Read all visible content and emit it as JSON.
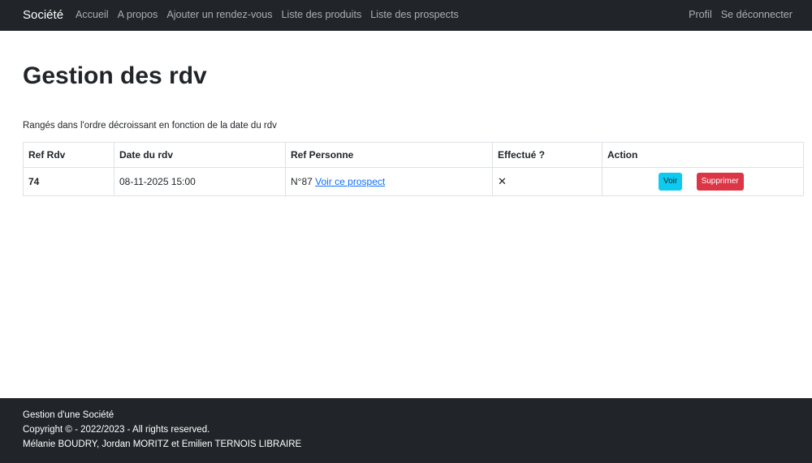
{
  "navbar": {
    "brand": "Société",
    "links": [
      "Accueil",
      "A propos",
      "Ajouter un rendez-vous",
      "Liste des produits",
      "Liste des prospects"
    ],
    "right_links": [
      "Profil",
      "Se déconnecter"
    ]
  },
  "page": {
    "title": "Gestion des rdv",
    "subtitle": "Rangés dans l'ordre décroissant en fonction de la date du rdv"
  },
  "table": {
    "headers": [
      "Ref Rdv",
      "Date du rdv",
      "Ref Personne",
      "Effectué ?",
      "Action"
    ],
    "rows": [
      {
        "ref": "74",
        "date": "08-11-2025 15:00",
        "person_prefix": "N°87",
        "person_link": "Voir ce prospect",
        "done": "✕",
        "view_label": "Voir",
        "delete_label": "Supprimer"
      }
    ]
  },
  "footer": {
    "line1": "Gestion d'une Société",
    "line2": "Copyright © - 2022/2023 - All rights reserved.",
    "line3": "Mélanie BOUDRY, Jordan MORITZ et Emilien TERNOIS LIBRAIRE"
  },
  "colors": {
    "navbar_bg": "#212529",
    "info_button": "#0dcaf0",
    "danger_button": "#dc3545",
    "link": "#0d6efd"
  }
}
